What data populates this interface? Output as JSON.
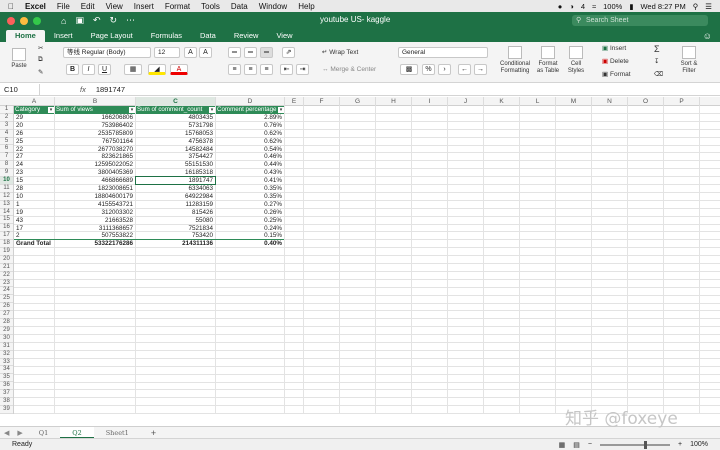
{
  "mac": {
    "app": "Excel",
    "menus": [
      "File",
      "Edit",
      "View",
      "Insert",
      "Format",
      "Tools",
      "Data",
      "Window",
      "Help"
    ],
    "battery": "100%",
    "clock": "Wed 8:27 PM",
    "badge": "4"
  },
  "window": {
    "title": "youtube US- kaggle",
    "search_placeholder": "Search Sheet"
  },
  "tabs": [
    "Home",
    "Insert",
    "Page Layout",
    "Formulas",
    "Data",
    "Review",
    "View"
  ],
  "ribbon": {
    "paste": "Paste",
    "font_name": "等线 Regular (Body)",
    "font_size": "12",
    "bold": "B",
    "italic": "I",
    "underline": "U",
    "wrap_text": "Wrap Text",
    "merge_center": "Merge & Center",
    "number_format": "General",
    "percent": "%",
    "conditional_formatting": "Conditional\nFormatting",
    "format_as_table": "Format\nas Table",
    "cell_styles": "Cell\nStyles",
    "insert": "Insert",
    "delete": "Delete",
    "format": "Format",
    "sort_filter": "Sort &\nFilter"
  },
  "formula_bar": {
    "name_box": "C10",
    "fx": "fx",
    "value": "1891747"
  },
  "columns": [
    "A",
    "B",
    "C",
    "D",
    "E",
    "F",
    "G",
    "H",
    "I",
    "J",
    "K",
    "L",
    "M",
    "N",
    "O",
    "P"
  ],
  "table": {
    "headers": [
      "Category",
      "Sum of views",
      "Sum of comment_count",
      "Comment percentage"
    ],
    "rows": [
      [
        "29",
        "166206806",
        "4803435",
        "2.89%"
      ],
      [
        "20",
        "753986402",
        "5731798",
        "0.76%"
      ],
      [
        "26",
        "2535785809",
        "15768053",
        "0.62%"
      ],
      [
        "25",
        "767501164",
        "4756378",
        "0.62%"
      ],
      [
        "22",
        "2677038270",
        "14582484",
        "0.54%"
      ],
      [
        "27",
        "823621865",
        "3754427",
        "0.46%"
      ],
      [
        "24",
        "12595022052",
        "55151530",
        "0.44%"
      ],
      [
        "23",
        "3800405369",
        "16185318",
        "0.43%"
      ],
      [
        "15",
        "466866689",
        "1891747",
        "0.41%"
      ],
      [
        "28",
        "1823008651",
        "6334063",
        "0.35%"
      ],
      [
        "10",
        "18804600179",
        "64922984",
        "0.35%"
      ],
      [
        "1",
        "4155543721",
        "11283159",
        "0.27%"
      ],
      [
        "19",
        "312003302",
        "815426",
        "0.26%"
      ],
      [
        "43",
        "21663528",
        "55080",
        "0.25%"
      ],
      [
        "17",
        "3111368657",
        "7521834",
        "0.24%"
      ],
      [
        "2",
        "507553822",
        "753420",
        "0.15%"
      ]
    ],
    "total": [
      "Grand Total",
      "53322176286",
      "214311136",
      "0.40%"
    ]
  },
  "row_count": 39,
  "selected_row": "10",
  "sheets": [
    "Q1",
    "Q2",
    "Sheet1"
  ],
  "active_sheet": "Q2",
  "status": {
    "ready": "Ready",
    "zoom": "100%"
  },
  "watermark": "知乎 @foxeye"
}
